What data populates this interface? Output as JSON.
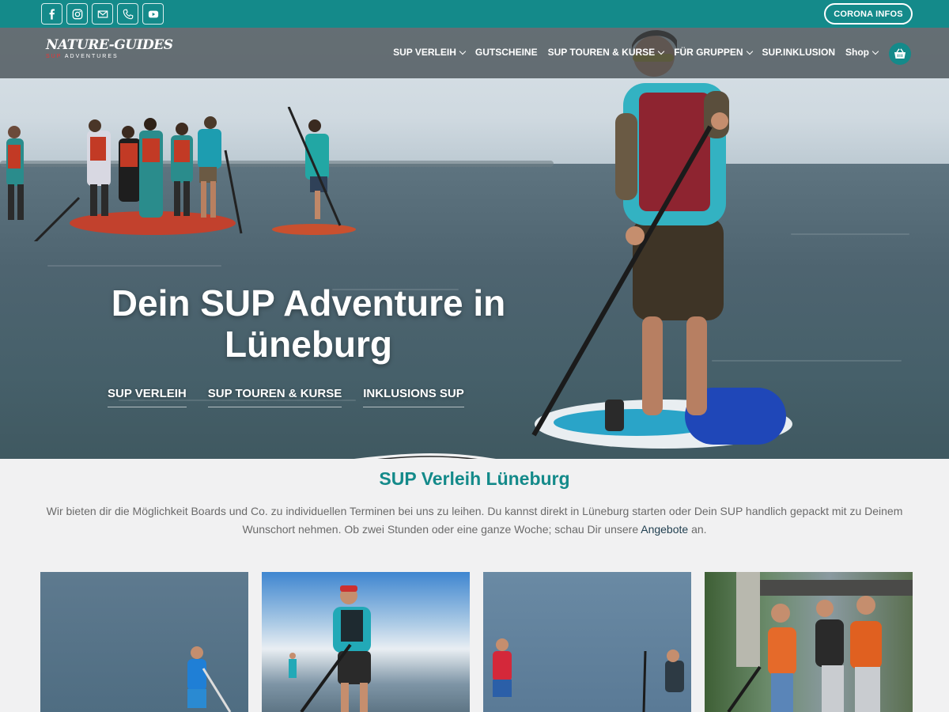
{
  "topbar": {
    "social": [
      {
        "name": "facebook",
        "icon": "facebook-icon"
      },
      {
        "name": "instagram",
        "icon": "instagram-icon"
      },
      {
        "name": "email",
        "icon": "envelope-icon"
      },
      {
        "name": "phone",
        "icon": "phone-icon"
      },
      {
        "name": "youtube",
        "icon": "youtube-icon"
      }
    ],
    "corona_button": "CORONA INFOS"
  },
  "header": {
    "logo_main": "NATURE-GUIDES",
    "logo_sub_accent": "SUP",
    "logo_sub": "ADVENTURES",
    "menu": [
      {
        "label": "SUP VERLEIH",
        "dropdown": true
      },
      {
        "label": "GUTSCHEINE",
        "dropdown": false
      },
      {
        "label": "SUP TOUREN & KURSE",
        "dropdown": true
      },
      {
        "label": "FÜR GRUPPEN",
        "dropdown": true
      },
      {
        "label": "SUP.INKLUSION",
        "dropdown": false
      },
      {
        "label": "Shop",
        "dropdown": true
      }
    ],
    "cart_icon": "basket-icon"
  },
  "hero": {
    "title_line1": "Dein SUP Adventure in",
    "title_line2": "Lüneburg",
    "links": [
      "SUP VERLEIH",
      "SUP TOUREN & KURSE",
      "INKLUSIONS SUP"
    ]
  },
  "section": {
    "title": "SUP Verleih Lüneburg",
    "intro_part1": "Wir bieten dir die Möglichkeit Boards und Co. zu individuellen Terminen bei uns zu leihen. Du kannst direkt in Lüneburg starten oder Dein SUP handlich gepackt mit zu Deinem Wunschort nehmen. Ob zwei Stunden oder eine ganze Woche; schau Dir unsere ",
    "intro_link": "Angebote",
    "intro_part2": " an."
  },
  "colors": {
    "brand": "#148a8a",
    "background": "#f1f1f2",
    "text": "#6a6a6a",
    "link": "#1f3e4f"
  }
}
